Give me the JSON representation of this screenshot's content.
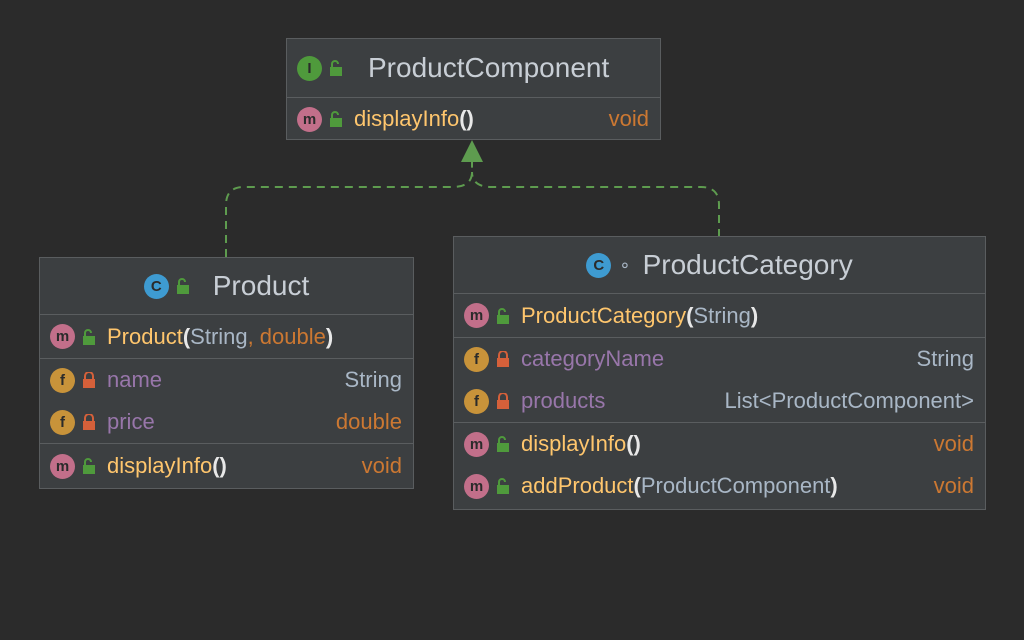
{
  "colors": {
    "background": "#2b2b2b",
    "box_fill": "#3c3f41",
    "method_name": "#ffc66d",
    "field_name": "#9876aa",
    "keyword": "#cc7832",
    "edge": "#5e9c4f"
  },
  "interface": {
    "badge": "I",
    "name": "ProductComponent",
    "methods": [
      {
        "badge": "m",
        "name": "displayInfo",
        "open": "(",
        "close": ")",
        "type": "void"
      }
    ]
  },
  "product": {
    "badge": "C",
    "name": "Product",
    "constructor": {
      "badge": "m",
      "name": "Product",
      "open": "(",
      "param1": "String",
      "sep": ",",
      "param2": "double",
      "close": ")"
    },
    "fields": [
      {
        "badge": "f",
        "name": "name",
        "type": "String"
      },
      {
        "badge": "f",
        "name": "price",
        "type": "double"
      }
    ],
    "methods": [
      {
        "badge": "m",
        "name": "displayInfo",
        "open": "(",
        "close": ")",
        "type": "void"
      }
    ]
  },
  "category": {
    "badge": "C",
    "visibility": "∘",
    "name": "ProductCategory",
    "constructor": {
      "badge": "m",
      "name": "ProductCategory",
      "open": "(",
      "param1": "String",
      "close": ")"
    },
    "fields": [
      {
        "badge": "f",
        "name": "categoryName",
        "type": "String"
      },
      {
        "badge": "f",
        "name": "products",
        "type": "List<ProductComponent>"
      }
    ],
    "methods": [
      {
        "badge": "m",
        "name": "displayInfo",
        "open": "(",
        "close": ")",
        "type": "void"
      },
      {
        "badge": "m",
        "name": "addProduct",
        "open": "(",
        "param1": "ProductComponent",
        "close": ")",
        "type": "void"
      }
    ]
  }
}
